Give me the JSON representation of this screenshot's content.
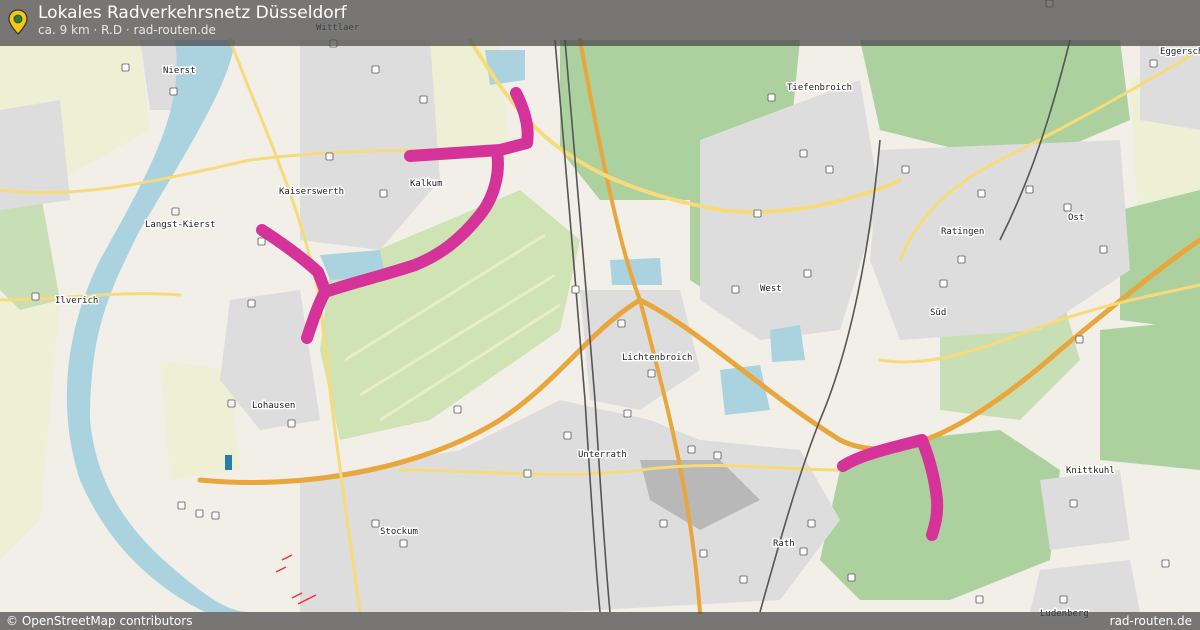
{
  "header": {
    "title": "Lokales Radverkehrsnetz Düsseldorf",
    "subtitle": "ca. 9 km · R.D · rad-routen.de",
    "icon": "map-pin-icon"
  },
  "footer": {
    "attribution": "© OpenStreetMap contributors",
    "brand": "rad-routen.de"
  },
  "places": [
    {
      "id": "wittlaer",
      "name": "Wittlaer"
    },
    {
      "id": "nierst",
      "name": "Nierst"
    },
    {
      "id": "eggersch",
      "name": "Eggersch"
    },
    {
      "id": "tiefenbroich",
      "name": "Tiefenbroich"
    },
    {
      "id": "kaiserswerth",
      "name": "Kaiserswerth"
    },
    {
      "id": "kalkum",
      "name": "Kalkum"
    },
    {
      "id": "langst-kierst",
      "name": "Langst-Kierst"
    },
    {
      "id": "ratingen",
      "name": "Ratingen"
    },
    {
      "id": "ost",
      "name": "Ost"
    },
    {
      "id": "ilverich",
      "name": "Ilverich"
    },
    {
      "id": "west",
      "name": "West"
    },
    {
      "id": "sued",
      "name": "Süd"
    },
    {
      "id": "lichtenbroich",
      "name": "Lichtenbroich"
    },
    {
      "id": "lohausen",
      "name": "Lohausen"
    },
    {
      "id": "unterrath",
      "name": "Unterrath"
    },
    {
      "id": "knittkuhl",
      "name": "Knittkuhl"
    },
    {
      "id": "stockum",
      "name": "Stockum"
    },
    {
      "id": "rath",
      "name": "Rath"
    },
    {
      "id": "ludenberg",
      "name": "Ludenberg"
    }
  ],
  "colors": {
    "route": "#d6339a",
    "forest": "#add19e",
    "water": "#aad3df",
    "urban": "#dddddd",
    "motorway": "#e8a63c",
    "primary": "#f7da7a"
  }
}
